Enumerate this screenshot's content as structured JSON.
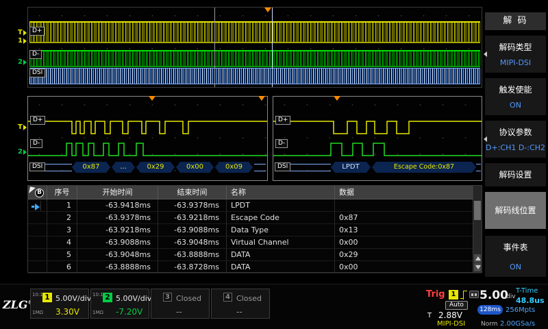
{
  "colors": {
    "ch1": "#e6e600",
    "ch2": "#00cc44",
    "decode_value": "#5599ff",
    "trigger_marker": "#ff8a00",
    "t_time": "#33ccff",
    "trig_label": "#ff4040"
  },
  "top_view": {
    "dplus_label": "D+",
    "dminus_label": "D-",
    "dsi_label": "DSI"
  },
  "gutter": {
    "trig": "T",
    "ch1": "1",
    "ch2": "2",
    "zoom_trig": "T",
    "zoom_ch2": "2"
  },
  "zoom_left": {
    "dplus_label": "D+",
    "dminus_label": "D-",
    "dsi_label": "DSI",
    "bubbles": [
      "0x87",
      "...",
      "0x29",
      "0x00",
      "0x09"
    ]
  },
  "zoom_right": {
    "dplus_label": "D+",
    "dminus_label": "D-",
    "dsi_label": "DSI",
    "bubbles": [
      "LPDT",
      "Escape Code:0x87"
    ]
  },
  "event_table": {
    "knob_label": "B",
    "headers": [
      "序号",
      "开始时间",
      "结束时间",
      "名称",
      "数据"
    ],
    "rows": [
      {
        "no": "1",
        "start": "-63.9418ms",
        "end": "-63.9378ms",
        "name": "LPDT",
        "data": ""
      },
      {
        "no": "2",
        "start": "-63.9378ms",
        "end": "-63.9218ms",
        "name": "Escape Code",
        "data": "0x87"
      },
      {
        "no": "3",
        "start": "-63.9218ms",
        "end": "-63.9088ms",
        "name": "Data Type",
        "data": "0x13"
      },
      {
        "no": "4",
        "start": "-63.9088ms",
        "end": "-63.9048ms",
        "name": "Virtual Channel",
        "data": "0x00"
      },
      {
        "no": "5",
        "start": "-63.9048ms",
        "end": "-63.8888ms",
        "name": "DATA",
        "data": "0x29"
      },
      {
        "no": "6",
        "start": "-63.8888ms",
        "end": "-63.8728ms",
        "name": "DATA",
        "data": "0x00"
      }
    ]
  },
  "sidebar": {
    "title": "解 码",
    "items": [
      {
        "label": "解码类型",
        "value": "MIPI-DSI"
      },
      {
        "label": "触发使能",
        "value": "ON"
      },
      {
        "label": "协议参数",
        "value": "D+:CH1 D-:CH2"
      },
      {
        "label": "解码设置",
        "value": ""
      },
      {
        "label": "解码线位置",
        "value": ""
      },
      {
        "label": "事件表",
        "value": "ON"
      }
    ]
  },
  "bottom": {
    "logo": "ZLG",
    "logo_reg": "®",
    "channels": [
      {
        "num": "1",
        "scale": "5.00V/div",
        "offset": "3.30V",
        "probe": "10:1",
        "impedance": "1MΩ"
      },
      {
        "num": "2",
        "scale": "5.00V/div",
        "offset": "-7.20V",
        "probe": "10:1",
        "impedance": "1MΩ"
      },
      {
        "num": "3",
        "scale": "Closed",
        "offset": "--",
        "probe": "",
        "impedance": ""
      },
      {
        "num": "4",
        "scale": "Closed",
        "offset": "--",
        "probe": "",
        "impedance": ""
      }
    ],
    "trigger": {
      "label": "Trig",
      "source": "1",
      "mode": "Auto",
      "t": "T",
      "level": "2.88V"
    },
    "timebase": {
      "value": "5.00",
      "unit": "div"
    },
    "memory": {
      "depth_time": "128ms",
      "points": "256Mpts"
    },
    "t_time": {
      "label": "T-Time",
      "value": "48.8us"
    },
    "status": {
      "decode": "MIPI-DSI",
      "acq": "Norm",
      "rate": "2.00GSa/s"
    }
  }
}
